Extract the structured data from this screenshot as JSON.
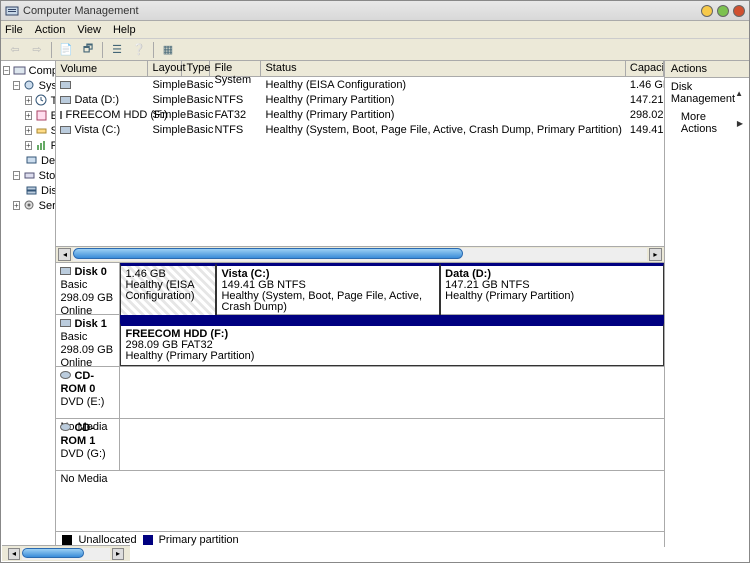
{
  "window": {
    "title": "Computer Management"
  },
  "menu": {
    "file": "File",
    "action": "Action",
    "view": "View",
    "help": "Help"
  },
  "tree": {
    "root": "Computer Management (Local)",
    "systools": "System Tools",
    "task": "Task Scheduler",
    "event": "Event Viewer",
    "shared": "Shared Folders",
    "reliab": "Reliability and Performance",
    "devmgr": "Device Manager",
    "storage": "Storage",
    "diskmgmt": "Disk Management",
    "services": "Services and Applications"
  },
  "cols": {
    "volume": "Volume",
    "layout": "Layout",
    "type": "Type",
    "fs": "File System",
    "status": "Status",
    "capacity": "Capacity"
  },
  "vols": [
    {
      "name": "",
      "layout": "Simple",
      "type": "Basic",
      "fs": "",
      "status": "Healthy (EISA Configuration)",
      "cap": "1.46 GB"
    },
    {
      "name": "Data (D:)",
      "layout": "Simple",
      "type": "Basic",
      "fs": "NTFS",
      "status": "Healthy (Primary Partition)",
      "cap": "147.21"
    },
    {
      "name": "FREECOM HDD (F:)",
      "layout": "Simple",
      "type": "Basic",
      "fs": "FAT32",
      "status": "Healthy (Primary Partition)",
      "cap": "298.02"
    },
    {
      "name": "Vista (C:)",
      "layout": "Simple",
      "type": "Basic",
      "fs": "NTFS",
      "status": "Healthy (System, Boot, Page File, Active, Crash Dump, Primary Partition)",
      "cap": "149.41"
    }
  ],
  "disks": {
    "d0": {
      "title": "Disk 0",
      "kind": "Basic",
      "size": "298.09 GB",
      "state": "Online",
      "p1": {
        "size": "1.46 GB",
        "status": "Healthy (EISA Configuration)"
      },
      "p2": {
        "name": "Vista  (C:)",
        "size": "149.41 GB NTFS",
        "status": "Healthy (System, Boot, Page File, Active, Crash Dump)"
      },
      "p3": {
        "name": "Data  (D:)",
        "size": "147.21 GB NTFS",
        "status": "Healthy (Primary Partition)"
      }
    },
    "d1": {
      "title": "Disk 1",
      "kind": "Basic",
      "size": "298.09 GB",
      "state": "Online",
      "p1": {
        "name": "FREECOM HDD  (F:)",
        "size": "298.09 GB FAT32",
        "status": "Healthy (Primary Partition)"
      }
    },
    "cd0": {
      "title": "CD-ROM 0",
      "sub": "DVD (E:)",
      "state": "No Media"
    },
    "cd1": {
      "title": "CD-ROM 1",
      "sub": "DVD (G:)",
      "state": "No Media"
    }
  },
  "legend": {
    "unalloc": "Unallocated",
    "primary": "Primary partition"
  },
  "actions": {
    "header": "Actions",
    "dm": "Disk Management",
    "more": "More Actions"
  }
}
